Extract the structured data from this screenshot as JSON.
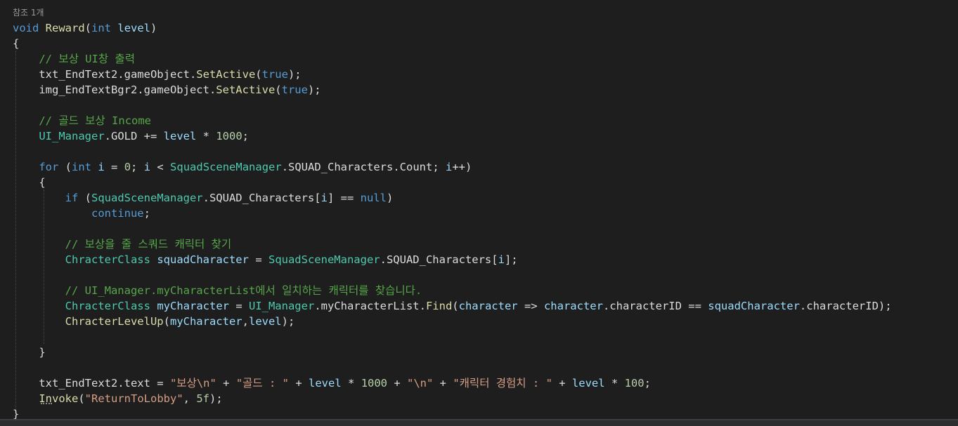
{
  "codelens": "참조 1개",
  "colors": {
    "background": "#1e1e1e",
    "keyword": "#569cd6",
    "type": "#4ec9b0",
    "method": "#dcdcaa",
    "variable": "#9cdcfe",
    "comment": "#57a64a",
    "string": "#d69d85",
    "number": "#b5cea8",
    "plain": "#dcdcdc"
  },
  "lines": [
    [
      {
        "t": "void",
        "c": "kw"
      },
      {
        "t": " ",
        "c": "p"
      },
      {
        "t": "Reward",
        "c": "m"
      },
      {
        "t": "(",
        "c": "p"
      },
      {
        "t": "int",
        "c": "kw"
      },
      {
        "t": " ",
        "c": "p"
      },
      {
        "t": "level",
        "c": "v"
      },
      {
        "t": ")",
        "c": "p"
      }
    ],
    [
      {
        "t": "{",
        "c": "p"
      }
    ],
    [
      {
        "t": "    ",
        "c": "p"
      },
      {
        "t": "// 보상 UI창 출력",
        "c": "cm"
      }
    ],
    [
      {
        "t": "    txt_EndText2.gameObject.",
        "c": "p"
      },
      {
        "t": "SetActive",
        "c": "m"
      },
      {
        "t": "(",
        "c": "p"
      },
      {
        "t": "true",
        "c": "kw"
      },
      {
        "t": ");",
        "c": "p"
      }
    ],
    [
      {
        "t": "    img_EndTextBgr2.gameObject.",
        "c": "p"
      },
      {
        "t": "SetActive",
        "c": "m"
      },
      {
        "t": "(",
        "c": "p"
      },
      {
        "t": "true",
        "c": "kw"
      },
      {
        "t": ");",
        "c": "p"
      }
    ],
    [],
    [
      {
        "t": "    ",
        "c": "p"
      },
      {
        "t": "// 골드 보상 Income",
        "c": "cm"
      }
    ],
    [
      {
        "t": "    ",
        "c": "p"
      },
      {
        "t": "UI_Manager",
        "c": "ty"
      },
      {
        "t": ".GOLD += ",
        "c": "p"
      },
      {
        "t": "level",
        "c": "v"
      },
      {
        "t": " * ",
        "c": "p"
      },
      {
        "t": "1000",
        "c": "n"
      },
      {
        "t": ";",
        "c": "p"
      }
    ],
    [],
    [
      {
        "t": "    ",
        "c": "p"
      },
      {
        "t": "for",
        "c": "kw"
      },
      {
        "t": " (",
        "c": "p"
      },
      {
        "t": "int",
        "c": "kw"
      },
      {
        "t": " ",
        "c": "p"
      },
      {
        "t": "i",
        "c": "v"
      },
      {
        "t": " = ",
        "c": "p"
      },
      {
        "t": "0",
        "c": "n"
      },
      {
        "t": "; ",
        "c": "p"
      },
      {
        "t": "i",
        "c": "v"
      },
      {
        "t": " < ",
        "c": "p"
      },
      {
        "t": "SquadSceneManager",
        "c": "ty"
      },
      {
        "t": ".SQUAD_Characters.Count; ",
        "c": "p"
      },
      {
        "t": "i",
        "c": "v"
      },
      {
        "t": "++)",
        "c": "p"
      }
    ],
    [
      {
        "t": "    {",
        "c": "p"
      }
    ],
    [
      {
        "t": "        ",
        "c": "p"
      },
      {
        "t": "if",
        "c": "kw"
      },
      {
        "t": " (",
        "c": "p"
      },
      {
        "t": "SquadSceneManager",
        "c": "ty"
      },
      {
        "t": ".SQUAD_Characters[",
        "c": "p"
      },
      {
        "t": "i",
        "c": "v"
      },
      {
        "t": "] == ",
        "c": "p"
      },
      {
        "t": "null",
        "c": "kw"
      },
      {
        "t": ")",
        "c": "p"
      }
    ],
    [
      {
        "t": "            ",
        "c": "p"
      },
      {
        "t": "continue",
        "c": "kw"
      },
      {
        "t": ";",
        "c": "p"
      }
    ],
    [],
    [
      {
        "t": "        ",
        "c": "p"
      },
      {
        "t": "// 보상을 줄 스쿼드 캐릭터 찾기",
        "c": "cm"
      }
    ],
    [
      {
        "t": "        ",
        "c": "p"
      },
      {
        "t": "ChracterClass",
        "c": "ty"
      },
      {
        "t": " ",
        "c": "p"
      },
      {
        "t": "squadCharacter",
        "c": "v"
      },
      {
        "t": " = ",
        "c": "p"
      },
      {
        "t": "SquadSceneManager",
        "c": "ty"
      },
      {
        "t": ".SQUAD_Characters[",
        "c": "p"
      },
      {
        "t": "i",
        "c": "v"
      },
      {
        "t": "];",
        "c": "p"
      }
    ],
    [],
    [
      {
        "t": "        ",
        "c": "p"
      },
      {
        "t": "// UI_Manager.myCharacterList에서 일치하는 캐릭터를 찾습니다.",
        "c": "cm"
      }
    ],
    [
      {
        "t": "        ",
        "c": "p"
      },
      {
        "t": "ChracterClass",
        "c": "ty"
      },
      {
        "t": " ",
        "c": "p"
      },
      {
        "t": "myCharacter",
        "c": "v"
      },
      {
        "t": " = ",
        "c": "p"
      },
      {
        "t": "UI_Manager",
        "c": "ty"
      },
      {
        "t": ".myCharacterList.",
        "c": "p"
      },
      {
        "t": "Find",
        "c": "m"
      },
      {
        "t": "(",
        "c": "p"
      },
      {
        "t": "character",
        "c": "v"
      },
      {
        "t": " => ",
        "c": "p"
      },
      {
        "t": "character",
        "c": "v"
      },
      {
        "t": ".characterID == ",
        "c": "p"
      },
      {
        "t": "squadCharacter",
        "c": "v"
      },
      {
        "t": ".characterID);",
        "c": "p"
      }
    ],
    [
      {
        "t": "        ",
        "c": "p"
      },
      {
        "t": "ChracterLevelUp",
        "c": "m"
      },
      {
        "t": "(",
        "c": "p"
      },
      {
        "t": "myCharacter",
        "c": "v"
      },
      {
        "t": ",",
        "c": "p"
      },
      {
        "t": "level",
        "c": "v"
      },
      {
        "t": ");",
        "c": "p"
      }
    ],
    [],
    [
      {
        "t": "    }",
        "c": "p"
      }
    ],
    [],
    [
      {
        "t": "    txt_EndText2.text = ",
        "c": "p"
      },
      {
        "t": "\"보상\\n\"",
        "c": "s"
      },
      {
        "t": " + ",
        "c": "p"
      },
      {
        "t": "\"골드 : \"",
        "c": "s"
      },
      {
        "t": " + ",
        "c": "p"
      },
      {
        "t": "level",
        "c": "v"
      },
      {
        "t": " * ",
        "c": "p"
      },
      {
        "t": "1000",
        "c": "n"
      },
      {
        "t": " + ",
        "c": "p"
      },
      {
        "t": "\"\\n\"",
        "c": "s"
      },
      {
        "t": " + ",
        "c": "p"
      },
      {
        "t": "\"캐릭터 경험치 : \"",
        "c": "s"
      },
      {
        "t": " + ",
        "c": "p"
      },
      {
        "t": "level",
        "c": "v"
      },
      {
        "t": " * ",
        "c": "p"
      },
      {
        "t": "100",
        "c": "n"
      },
      {
        "t": ";",
        "c": "p"
      }
    ],
    [
      {
        "t": "    ",
        "c": "p"
      },
      {
        "t": "Invoke",
        "c": "m"
      },
      {
        "t": "(",
        "c": "p"
      },
      {
        "t": "\"ReturnToLobby\"",
        "c": "s"
      },
      {
        "t": ", ",
        "c": "p"
      },
      {
        "t": "5f",
        "c": "n"
      },
      {
        "t": ");",
        "c": "p"
      }
    ],
    [
      {
        "t": "}",
        "c": "p"
      }
    ]
  ]
}
